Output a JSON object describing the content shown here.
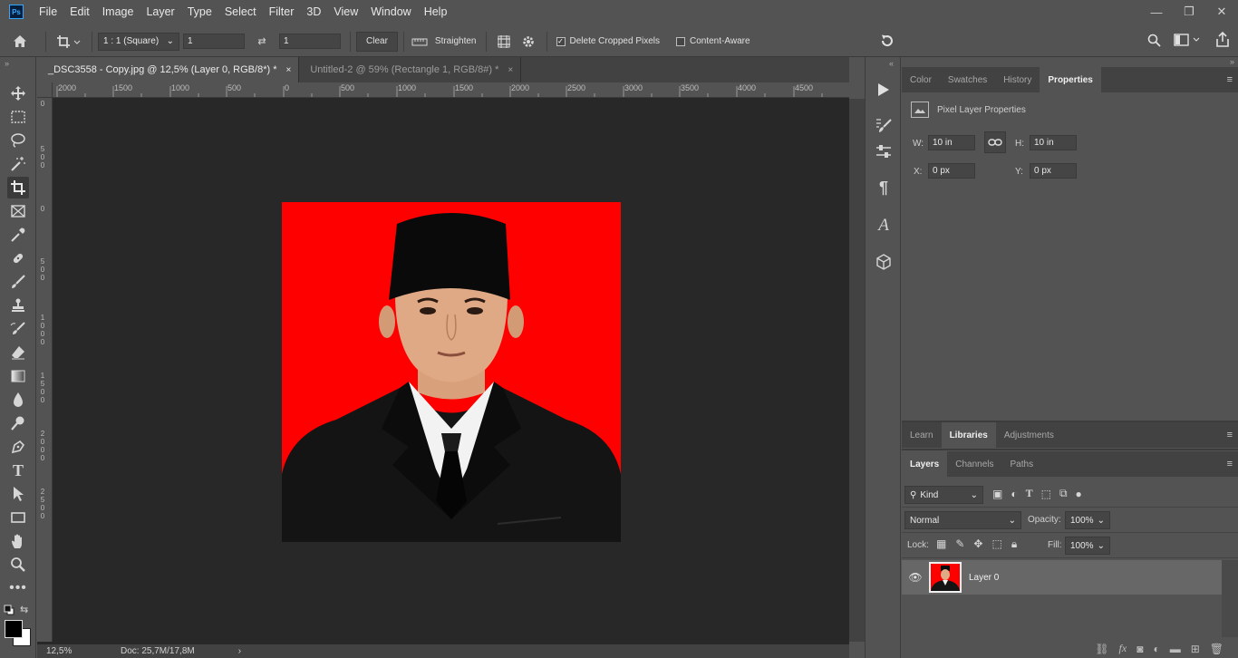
{
  "menubar": {
    "logo": "Ps",
    "items": [
      "File",
      "Edit",
      "Image",
      "Layer",
      "Type",
      "Select",
      "Filter",
      "3D",
      "View",
      "Window",
      "Help"
    ]
  },
  "options": {
    "ratio": "1 : 1 (Square)",
    "width_value": "1",
    "height_value": "1",
    "clear": "Clear",
    "straighten": "Straighten",
    "delete_cropped": "Delete Cropped Pixels",
    "delete_cropped_checked": true,
    "content_aware": "Content-Aware",
    "content_aware_checked": false
  },
  "tabs": [
    {
      "label": "_DSC3558 - Copy.jpg @ 12,5% (Layer 0, RGB/8*) *",
      "active": true,
      "close": "×"
    },
    {
      "label": "Untitled-2 @ 59% (Rectangle 1, RGB/8#) *",
      "active": false,
      "close": "×"
    }
  ],
  "ruler": {
    "h_labels": [
      "2000",
      "1500",
      "1000",
      "500",
      "0",
      "500",
      "1000",
      "1500",
      "2000",
      "2500",
      "3000",
      "3500",
      "4000",
      "4500"
    ],
    "v_labels": [
      "0",
      "5 0 0",
      "0",
      "5 0 0",
      "1 0 0 0",
      "1 5 0 0",
      "2 0 0 0",
      "2 5 0 0"
    ]
  },
  "status": {
    "zoom": "12,5%",
    "doc": "Doc: 25,7M/17,8M",
    "arrow": "›"
  },
  "properties_panel": {
    "tabs": [
      "Color",
      "Swatches",
      "History",
      "Properties"
    ],
    "active_tab": "Properties",
    "title": "Pixel Layer Properties",
    "w_label": "W:",
    "w_value": "10 in",
    "h_label": "H:",
    "h_value": "10 in",
    "x_label": "X:",
    "x_value": "0 px",
    "y_label": "Y:",
    "y_value": "0 px"
  },
  "libraries_panel": {
    "tabs": [
      "Learn",
      "Libraries",
      "Adjustments"
    ],
    "active_tab": "Libraries"
  },
  "layers_panel": {
    "tabs": [
      "Layers",
      "Channels",
      "Paths"
    ],
    "active_tab": "Layers",
    "filter_kind": "Kind",
    "blend_mode": "Normal",
    "opacity_label": "Opacity:",
    "opacity_value": "100%",
    "lock_label": "Lock:",
    "fill_label": "Fill:",
    "fill_value": "100%",
    "layers": [
      {
        "name": "Layer 0",
        "visible": true
      }
    ]
  },
  "colors": {
    "accent": "#31a8ff",
    "panel": "#535353",
    "canvas": "#282828",
    "photo_bg": "#ff0000"
  }
}
